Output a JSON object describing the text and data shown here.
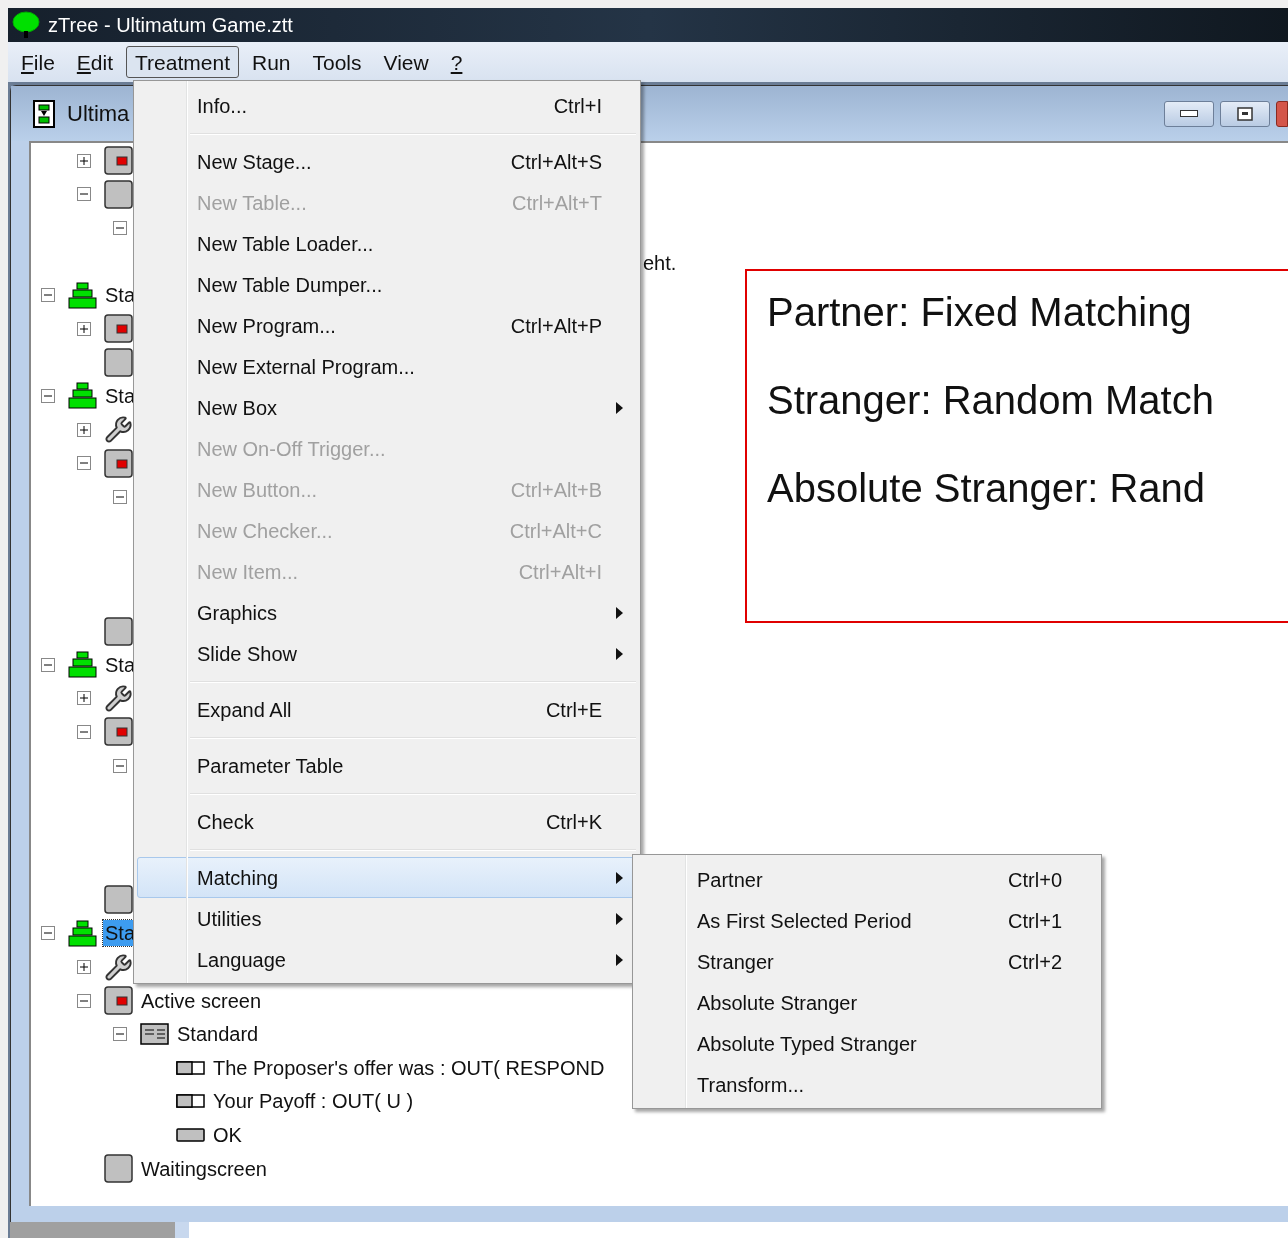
{
  "window": {
    "title": "zTree - Ultimatum Game.ztt"
  },
  "menu_bar": [
    {
      "label": "File",
      "underline_first": true,
      "selected": false
    },
    {
      "label": "Edit",
      "underline_first": true,
      "selected": false
    },
    {
      "label": "Treatment",
      "underline_first": false,
      "selected": true
    },
    {
      "label": "Run",
      "underline_first": false,
      "selected": false
    },
    {
      "label": "Tools",
      "underline_first": false,
      "selected": false
    },
    {
      "label": "View",
      "underline_first": false,
      "selected": false
    },
    {
      "label": "?",
      "underline_first": true,
      "selected": false
    }
  ],
  "child_window": {
    "title": "Ultima"
  },
  "tree": [
    {
      "kind": "offscreen",
      "children": [
        {
          "kind": "screen",
          "expanded": false
        },
        {
          "kind": "box",
          "expanded": true,
          "children": [
            {
              "kind": "covered",
              "expanded": true
            }
          ]
        }
      ]
    },
    {
      "kind": "stage",
      "label": "Sta",
      "expanded": true,
      "selected": false,
      "children": [
        {
          "kind": "screen",
          "expanded": false
        },
        {
          "kind": "box"
        }
      ]
    },
    {
      "kind": "stage",
      "label": "Sta",
      "expanded": true,
      "selected": false,
      "children": [
        {
          "kind": "program",
          "expanded": false
        },
        {
          "kind": "screen",
          "expanded": true,
          "children": [
            {
              "kind": "covered",
              "expanded": true
            }
          ]
        },
        {
          "kind": "box"
        }
      ]
    },
    {
      "kind": "stage",
      "label": "Sta",
      "expanded": true,
      "selected": false,
      "children": [
        {
          "kind": "program",
          "expanded": false
        },
        {
          "kind": "screen",
          "expanded": true,
          "children": [
            {
              "kind": "covered",
              "expanded": true
            }
          ]
        },
        {
          "kind": "box"
        }
      ]
    },
    {
      "kind": "stage",
      "label": "Sta",
      "expanded": true,
      "selected": true,
      "children": [
        {
          "kind": "program",
          "expanded": false
        },
        {
          "kind": "screen",
          "label": "Active screen",
          "expanded": true,
          "children": [
            {
              "kind": "layout",
              "label": "Standard",
              "expanded": true,
              "children": [
                {
                  "kind": "item",
                  "label": "The Proposer's offer was : OUT( RESPOND"
                },
                {
                  "kind": "item",
                  "label": "Your Payoff : OUT( U )"
                },
                {
                  "kind": "button",
                  "label": "OK"
                }
              ]
            }
          ]
        },
        {
          "kind": "box",
          "label": "Waitingscreen"
        }
      ]
    }
  ],
  "content": {
    "text_fragment": "eht.",
    "note_lines": [
      "Partner: Fixed Matching",
      "Stranger: Random Match",
      "Absolute Stranger: Rand"
    ]
  },
  "treatment_menu": [
    {
      "kind": "item",
      "label": "Info...",
      "shortcut": "Ctrl+I",
      "disabled": false,
      "submenu": false,
      "selected": false
    },
    {
      "kind": "separator"
    },
    {
      "kind": "item",
      "label": "New Stage...",
      "shortcut": "Ctrl+Alt+S",
      "disabled": false,
      "submenu": false,
      "selected": false
    },
    {
      "kind": "item",
      "label": "New Table...",
      "shortcut": "Ctrl+Alt+T",
      "disabled": true,
      "submenu": false,
      "selected": false
    },
    {
      "kind": "item",
      "label": "New Table Loader...",
      "disabled": false,
      "submenu": false,
      "selected": false
    },
    {
      "kind": "item",
      "label": "New Table Dumper...",
      "disabled": false,
      "submenu": false,
      "selected": false
    },
    {
      "kind": "item",
      "label": "New Program...",
      "shortcut": "Ctrl+Alt+P",
      "disabled": false,
      "submenu": false,
      "selected": false
    },
    {
      "kind": "item",
      "label": "New External Program...",
      "disabled": false,
      "submenu": false,
      "selected": false
    },
    {
      "kind": "item",
      "label": "New Box",
      "disabled": false,
      "submenu": true,
      "selected": false
    },
    {
      "kind": "item",
      "label": "New On-Off Trigger...",
      "disabled": true,
      "submenu": false,
      "selected": false
    },
    {
      "kind": "item",
      "label": "New Button...",
      "shortcut": "Ctrl+Alt+B",
      "disabled": true,
      "submenu": false,
      "selected": false
    },
    {
      "kind": "item",
      "label": "New Checker...",
      "shortcut": "Ctrl+Alt+C",
      "disabled": true,
      "submenu": false,
      "selected": false
    },
    {
      "kind": "item",
      "label": "New Item...",
      "shortcut": "Ctrl+Alt+I",
      "disabled": true,
      "submenu": false,
      "selected": false
    },
    {
      "kind": "item",
      "label": "Graphics",
      "disabled": false,
      "submenu": true,
      "selected": false
    },
    {
      "kind": "item",
      "label": "Slide Show",
      "disabled": false,
      "submenu": true,
      "selected": false
    },
    {
      "kind": "separator"
    },
    {
      "kind": "item",
      "label": "Expand All",
      "shortcut": "Ctrl+E",
      "disabled": false,
      "submenu": false,
      "selected": false
    },
    {
      "kind": "separator"
    },
    {
      "kind": "item",
      "label": "Parameter Table",
      "disabled": false,
      "submenu": false,
      "selected": false
    },
    {
      "kind": "separator"
    },
    {
      "kind": "item",
      "label": "Check",
      "shortcut": "Ctrl+K",
      "disabled": false,
      "submenu": false,
      "selected": false
    },
    {
      "kind": "separator"
    },
    {
      "kind": "item",
      "label": "Matching",
      "disabled": false,
      "submenu": true,
      "selected": true
    },
    {
      "kind": "item",
      "label": "Utilities",
      "disabled": false,
      "submenu": true,
      "selected": false
    },
    {
      "kind": "item",
      "label": "Language",
      "disabled": false,
      "submenu": true,
      "selected": false
    }
  ],
  "matching_submenu": [
    {
      "label": "Partner",
      "shortcut": "Ctrl+0"
    },
    {
      "label": "As First Selected Period",
      "shortcut": "Ctrl+1"
    },
    {
      "label": "Stranger",
      "shortcut": "Ctrl+2"
    },
    {
      "label": "Absolute Stranger"
    },
    {
      "label": "Absolute Typed Stranger"
    },
    {
      "label": "Transform..."
    }
  ]
}
